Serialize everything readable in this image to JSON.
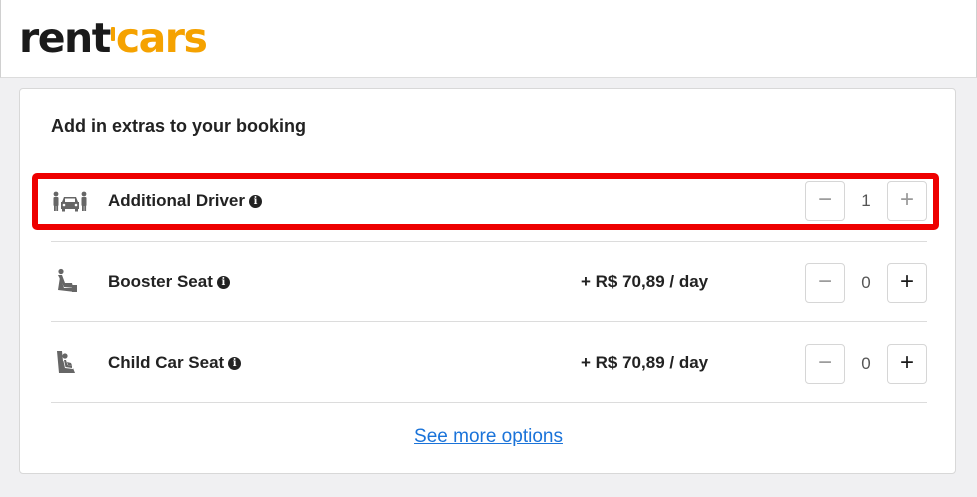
{
  "header": {
    "logo_part1": "rent",
    "logo_part2": "cars"
  },
  "extras": {
    "title": "Add in extras to your booking",
    "items": [
      {
        "label": "Additional Driver",
        "price": "",
        "quantity": "1",
        "icon": "driver-car-icon"
      },
      {
        "label": "Booster Seat",
        "price": "+ R$ 70,89 / day",
        "quantity": "0",
        "icon": "booster-seat-icon"
      },
      {
        "label": "Child Car Seat",
        "price": "+ R$ 70,89 / day",
        "quantity": "0",
        "icon": "child-seat-icon"
      }
    ],
    "stepper": {
      "minus": "−",
      "plus": "+"
    },
    "see_more": "See more options"
  },
  "colors": {
    "brand_dark": "#1a1a1a",
    "brand_accent": "#f5a200",
    "link": "#1a73d9",
    "highlight": "#ee0000"
  }
}
